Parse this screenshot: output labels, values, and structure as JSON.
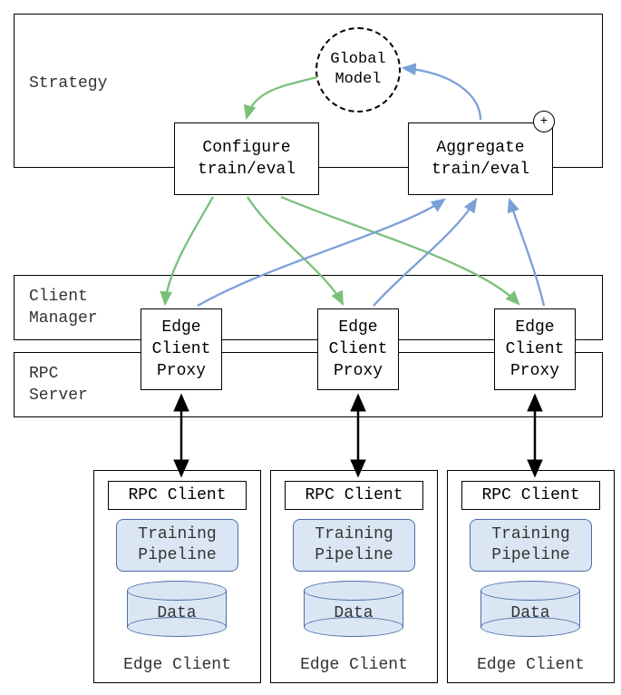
{
  "strategy": {
    "title": "Strategy",
    "global_model": "Global\nModel",
    "configure": "Configure\ntrain/eval",
    "aggregate": "Aggregate\ntrain/eval",
    "plus": "+"
  },
  "client_manager": {
    "title": "Client\nManager"
  },
  "rpc_server": {
    "title": "RPC\nServer"
  },
  "proxies": [
    "Edge\nClient\nProxy",
    "Edge\nClient\nProxy",
    "Edge\nClient\nProxy"
  ],
  "clients": [
    {
      "rpc": "RPC Client",
      "pipeline": "Training\nPipeline",
      "data": "Data",
      "label": "Edge Client"
    },
    {
      "rpc": "RPC Client",
      "pipeline": "Training\nPipeline",
      "data": "Data",
      "label": "Edge Client"
    },
    {
      "rpc": "RPC Client",
      "pipeline": "Training\nPipeline",
      "data": "Data",
      "label": "Edge Client"
    }
  ],
  "colors": {
    "green": "#7ac07a",
    "blue": "#7aa0d8",
    "black": "#000000"
  }
}
